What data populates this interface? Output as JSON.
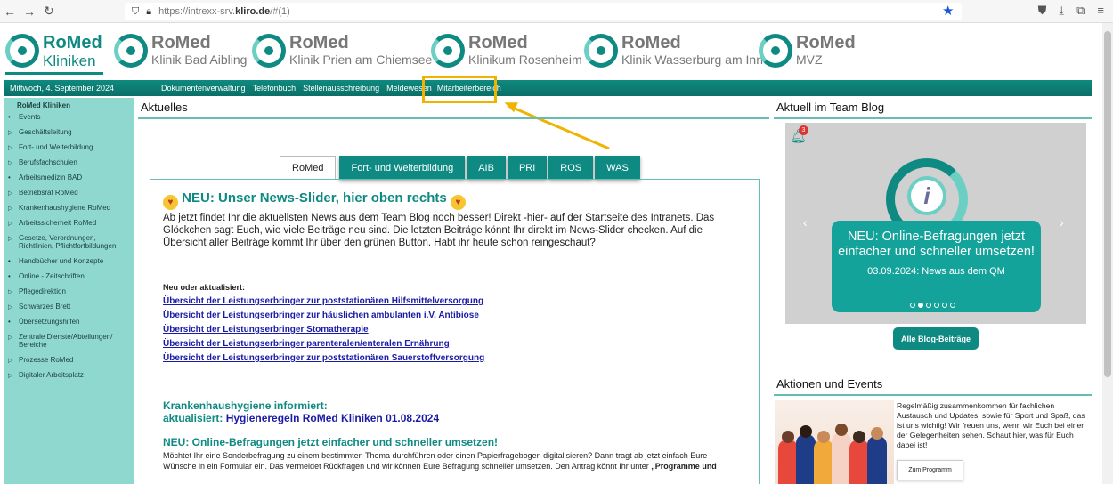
{
  "browser": {
    "url_gray": "https://intrexx-srv.",
    "url_domain": "kliro.de",
    "url_rest": "/#(1)"
  },
  "logos": [
    {
      "name": "RoMed",
      "sub": "Kliniken"
    },
    {
      "name": "RoMed",
      "sub": "Klinik Bad Aibling"
    },
    {
      "name": "RoMed",
      "sub": "Klinik Prien am Chiemsee"
    },
    {
      "name": "RoMed",
      "sub": "Klinikum Rosenheim"
    },
    {
      "name": "RoMed",
      "sub": "Klinik Wasserburg am Inn"
    },
    {
      "name": "RoMed",
      "sub": "MVZ"
    }
  ],
  "nav": {
    "date": "Mittwoch, 4. September 2024",
    "items": [
      "Dokumentenverwaltung",
      "Telefonbuch",
      "Stellenausschreibung",
      "Meldewesen",
      "Mitarbeiterbereich"
    ]
  },
  "sidebar": {
    "head": "RoMed Kliniken",
    "items": [
      {
        "type": "bullet",
        "label": "Events"
      },
      {
        "type": "expand",
        "label": "Geschäftsleitung"
      },
      {
        "type": "expand",
        "label": "Fort- und Weiterbildung"
      },
      {
        "type": "expand",
        "label": "Berufsfachschulen"
      },
      {
        "type": "bullet",
        "label": "Arbeitsmedizin BAD"
      },
      {
        "type": "expand",
        "label": "Betriebsrat RoMed"
      },
      {
        "type": "expand",
        "label": "Krankenhaushygiene RoMed"
      },
      {
        "type": "expand",
        "label": "Arbeitssicherheit RoMed"
      },
      {
        "type": "expand",
        "label": "Gesetze, Verordnungen, Richtlinien, Pflichtfortbildungen"
      },
      {
        "type": "bullet",
        "label": "Handbücher und Konzepte"
      },
      {
        "type": "bullet",
        "label": "Online - Zeitschriften"
      },
      {
        "type": "expand",
        "label": "Pflegedirektion"
      },
      {
        "type": "expand",
        "label": "Schwarzes Brett"
      },
      {
        "type": "bullet",
        "label": "Übersetzungshilfen"
      },
      {
        "type": "expand",
        "label": "Zentrale Dienste/Abteilungen/ Bereiche"
      },
      {
        "type": "expand",
        "label": "Prozesse RoMed"
      },
      {
        "type": "expand",
        "label": "Digitaler Arbeitsplatz"
      }
    ]
  },
  "main": {
    "title": "Aktuelles",
    "tabs": [
      "RoMed",
      "Fort- und Weiterbildung",
      "AIB",
      "PRI",
      "ROS",
      "WAS"
    ],
    "news_head": "NEU: Unser News-Slider, hier oben rechts",
    "intro": "Ab jetzt findet Ihr die aktuellsten News aus dem Team Blog noch besser! Direkt -hier- auf der Startseite des Intranets. Das Glöckchen sagt Euch, wie viele Beiträge neu sind. Die letzten Beiträge könnt Ihr direkt im News-Slider checken. Auf die Übersicht aller Beiträge kommt Ihr über den grünen Button. Habt ihr heute schon reingeschaut?",
    "list_head": "Neu oder aktualisiert:",
    "links": [
      "Übersicht der Leistungserbringer zur poststationären Hilfsmittelversorgung",
      "Übersicht der Leistungserbringer zur häuslichen ambulanten i.V. Antibiose",
      "Übersicht der Leistungserbringer Stomatherapie",
      "Übersicht der Leistungserbringer parenteralen/enteralen Ernährung",
      "Übersicht der Leistungserbringer zur poststationären Sauerstoffversorgung"
    ],
    "hyg_head": "Krankenhaushygiene informiert:",
    "hyg_prefix": "aktualisiert: ",
    "hyg_link": "Hygieneregeln RoMed Kliniken 01.08.2024",
    "online_head": "NEU: Online-Befragungen jetzt einfacher und schneller umsetzen!",
    "online_text_1": "Möchtet Ihr eine Sonderbefragung zu einem bestimmten Thema durchführen oder einen Papierfragebogen digitalisieren? Dann tragt ab jetzt einfach Eure",
    "online_text_2": "Wünsche in ein Formular ein. Das vermeidet Rückfragen und wir können Eure Befragung schneller umsetzen. Den Antrag könnt Ihr unter",
    "online_text_bold": " „Programme und"
  },
  "blog": {
    "title": "Aktuell im Team Blog",
    "bell_count": "3",
    "slide_title": "NEU: Online-Befragungen jetzt einfacher und schneller umsetzen!",
    "slide_date": "03.09.2024: News aus dem QM",
    "dot_count": 6,
    "active_dot": 1,
    "button": "Alle Blog-Beiträge"
  },
  "events": {
    "title": "Aktionen und Events",
    "text": "Regelmäßig zusammenkommen für fachlichen Austausch und Updates, sowie für Sport und Spaß, das ist uns wichtig! Wir freuen uns, wenn wir Euch bei einer der Gelegenheiten sehen. Schaut hier, was für Euch dabei ist!",
    "button": "Zum Programm"
  },
  "colors": {
    "accent": "#0f8a82",
    "highlight": "#f0b400",
    "sidebar": "#8fd8d0"
  }
}
